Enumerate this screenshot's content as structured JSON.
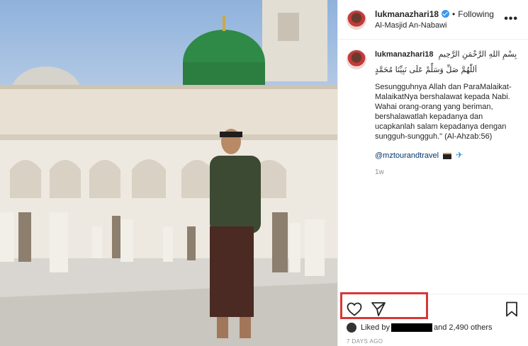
{
  "post": {
    "username": "lukmanazhari18",
    "follow_status": "Following",
    "separator": "•",
    "location": "Al-Masjid An-Nabawi",
    "more_icon": "more-options-icon"
  },
  "caption": {
    "username": "lukmanazhari18",
    "arabic_opening": "بِسْمِ اللهِ الرَّحْمَنِ الرَّحِيمِ",
    "arabic_salawat": "اَللّٰهُمَّ صَلِّ وَسَلِّمْ عَلَى نَبِيِّنَا مُحَمَّدٍ",
    "text": "Sesungguhnya Allah dan ParaMalaikat-MalaikatNya bershalawat kepada Nabi. Wahai orang-orang yang beriman, bershalawatlah kepadanya dan ucapkanlah salam kepadanya dengan sungguh-sungguh.\" (Al-Ahzab:56)",
    "mention": "@mztourandtravel",
    "time_ago": "1w"
  },
  "actions": {
    "like_icon": "heart-icon",
    "share_icon": "paper-plane-icon",
    "save_icon": "bookmark-icon"
  },
  "likes": {
    "prefix": "Liked by",
    "suffix": "and 2,490 others"
  },
  "date": "7 DAYS AGO",
  "colors": {
    "highlight": "#d93636",
    "link": "#003569",
    "verified": "#3897f0",
    "dome": "#2e8a46"
  }
}
